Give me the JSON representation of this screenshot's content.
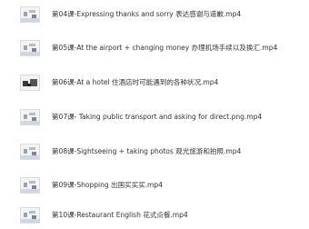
{
  "files": [
    {
      "name": "第04课-Expressing thanks and sorry 表达感谢与道歉.mp4",
      "icon": "video-thumbnail-icon"
    },
    {
      "name": "第05课-At the airport + changing money 办理机场手续以及换汇.mp4",
      "icon": "video-thumbnail-icon"
    },
    {
      "name": "第06课-At a hotel 住酒店时可能遇到的各种状况.mp4",
      "icon": "video-thumbnail-icon"
    },
    {
      "name": "第07课- Taking public transport and asking for direct.png.mp4",
      "icon": "video-thumbnail-icon"
    },
    {
      "name": "第08课-Sightseeing + taking photos 观光旅游和拍照.mp4",
      "icon": "video-thumbnail-icon"
    },
    {
      "name": "第09课-Shopping 出国买买买.mp4",
      "icon": "video-thumbnail-icon"
    },
    {
      "name": "第10课-Restaurant English 花式点餐.mp4",
      "icon": "video-thumbnail-icon"
    }
  ]
}
